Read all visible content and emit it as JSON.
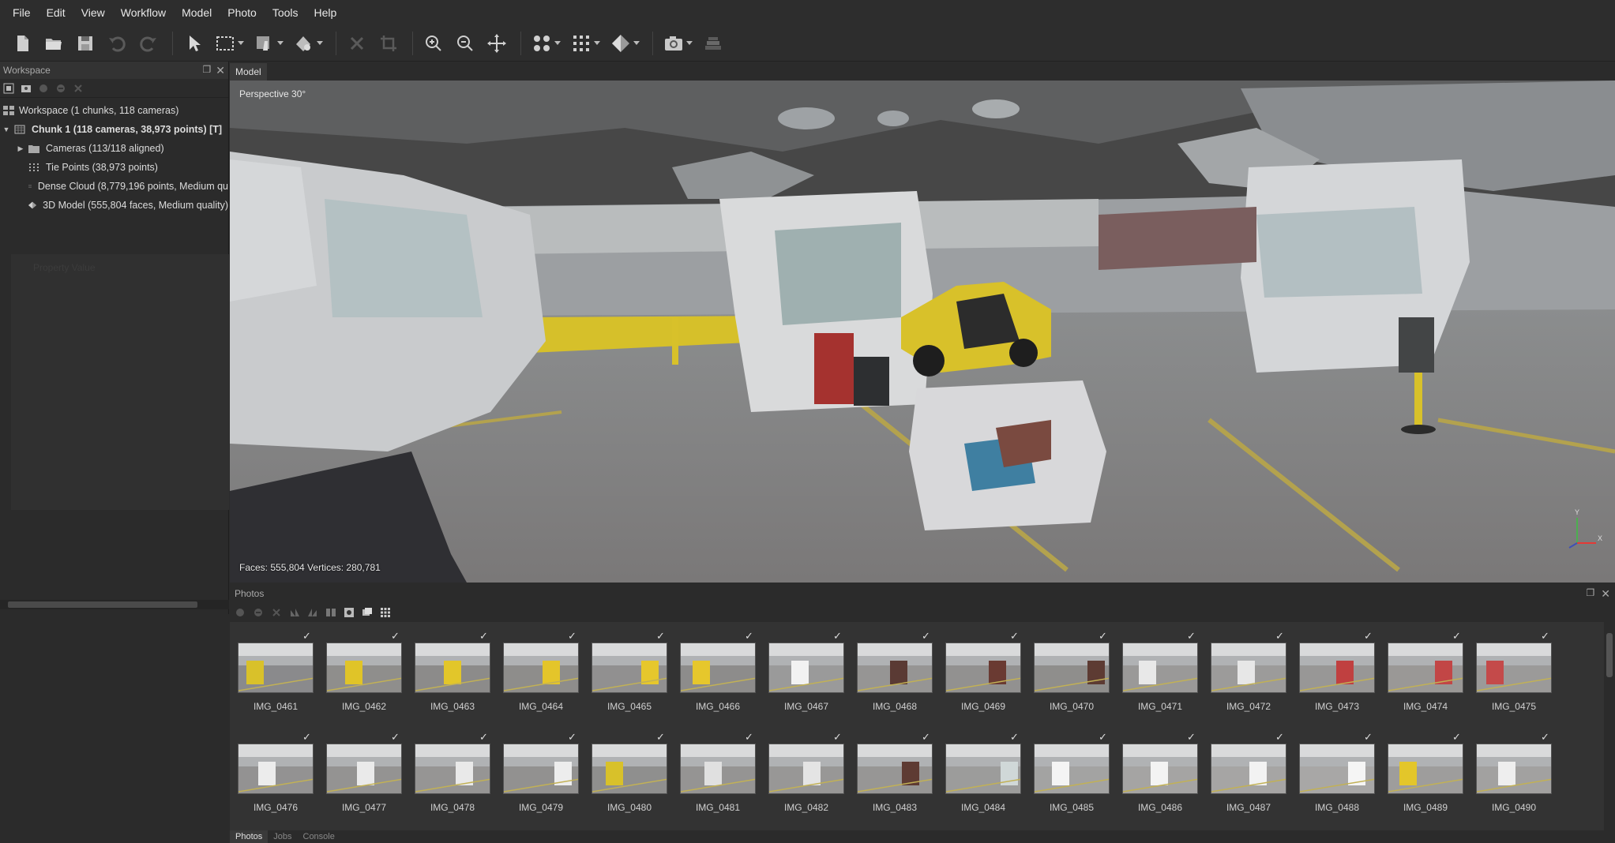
{
  "menu": [
    "File",
    "Edit",
    "View",
    "Workflow",
    "Model",
    "Photo",
    "Tools",
    "Help"
  ],
  "toolbar": {
    "icons": [
      "new-document-icon",
      "open-folder-icon",
      "save-icon",
      "undo-icon",
      "redo-icon",
      "pointer-icon",
      "rectangle-selection-icon",
      "navigation-mode-icon",
      "model-view-icon",
      "delete-icon",
      "crop-icon",
      "zoom-in-icon",
      "zoom-out-icon",
      "move-icon",
      "shaded-view-icon",
      "point-cloud-icon",
      "solid-model-icon",
      "camera-icon",
      "layers-icon"
    ]
  },
  "workspace": {
    "title": "Workspace",
    "tree": [
      {
        "label": "Workspace (1 chunks, 118 cameras)",
        "bold": false,
        "level": 0,
        "arrow": "",
        "icon": "workspace-icon"
      },
      {
        "label": "Chunk 1 (118 cameras, 38,973 points) [T]",
        "bold": true,
        "level": 0,
        "arrow": "▼",
        "icon": "chunk-icon"
      },
      {
        "label": "Cameras (113/118 aligned)",
        "bold": false,
        "level": 1,
        "arrow": "▶",
        "icon": "folder-icon"
      },
      {
        "label": "Tie Points (38,973 points)",
        "bold": false,
        "level": 1,
        "arrow": "",
        "icon": "tie-points-icon"
      },
      {
        "label": "Dense Cloud (8,779,196 points, Medium qu",
        "bold": false,
        "level": 1,
        "arrow": "",
        "icon": "dense-cloud-icon"
      },
      {
        "label": "3D Model (555,804 faces, Medium quality)",
        "bold": false,
        "level": 1,
        "arrow": "",
        "icon": "mesh-icon"
      }
    ],
    "empty_hint": "Property    Value"
  },
  "model": {
    "tab": "Model",
    "view_label": "Perspective 30°",
    "stats": "Faces: 555,804 Vertices: 280,781",
    "axis_x": "X",
    "axis_y": "Y"
  },
  "photos": {
    "title": "Photos",
    "items": [
      {
        "name": "IMG_0461",
        "tone": "#8a8a8c",
        "accent": "#d9c12a"
      },
      {
        "name": "IMG_0462",
        "tone": "#8f8e8c",
        "accent": "#e0c428"
      },
      {
        "name": "IMG_0463",
        "tone": "#8c8b8a",
        "accent": "#e2c62a"
      },
      {
        "name": "IMG_0464",
        "tone": "#8e8d8b",
        "accent": "#e4c52a"
      },
      {
        "name": "IMG_0465",
        "tone": "#919090",
        "accent": "#e6c72c"
      },
      {
        "name": "IMG_0466",
        "tone": "#8d8c8b",
        "accent": "#e6c72c"
      },
      {
        "name": "IMG_0467",
        "tone": "#9a9a9a",
        "accent": "#f2f2f2"
      },
      {
        "name": "IMG_0468",
        "tone": "#969594",
        "accent": "#5a3a34"
      },
      {
        "name": "IMG_0469",
        "tone": "#929190",
        "accent": "#6a3a32"
      },
      {
        "name": "IMG_0470",
        "tone": "#8f8e8c",
        "accent": "#5d3b33"
      },
      {
        "name": "IMG_0471",
        "tone": "#9a9998",
        "accent": "#e8e8e8"
      },
      {
        "name": "IMG_0472",
        "tone": "#9c9b9a",
        "accent": "#e7e7e7"
      },
      {
        "name": "IMG_0473",
        "tone": "#989796",
        "accent": "#c04040"
      },
      {
        "name": "IMG_0474",
        "tone": "#9a9896",
        "accent": "#c24646"
      },
      {
        "name": "IMG_0475",
        "tone": "#9b9a99",
        "accent": "#c44a4a"
      },
      {
        "name": "IMG_0476",
        "tone": "#939292",
        "accent": "#ececec"
      },
      {
        "name": "IMG_0477",
        "tone": "#949392",
        "accent": "#eaeaea"
      },
      {
        "name": "IMG_0478",
        "tone": "#969594",
        "accent": "#e9e9e9"
      },
      {
        "name": "IMG_0479",
        "tone": "#929190",
        "accent": "#ededed"
      },
      {
        "name": "IMG_0480",
        "tone": "#8f8f8e",
        "accent": "#d8c12a"
      },
      {
        "name": "IMG_0481",
        "tone": "#959493",
        "accent": "#e0e0e0"
      },
      {
        "name": "IMG_0482",
        "tone": "#989796",
        "accent": "#e4e4e4"
      },
      {
        "name": "IMG_0483",
        "tone": "#979695",
        "accent": "#5e3b33"
      },
      {
        "name": "IMG_0484",
        "tone": "#9c9c9b",
        "accent": "#d0d8d8"
      },
      {
        "name": "IMG_0485",
        "tone": "#a3a3a2",
        "accent": "#f4f4f4"
      },
      {
        "name": "IMG_0486",
        "tone": "#a5a4a3",
        "accent": "#f3f3f3"
      },
      {
        "name": "IMG_0487",
        "tone": "#a6a5a4",
        "accent": "#f2f2f2"
      },
      {
        "name": "IMG_0488",
        "tone": "#a8a7a6",
        "accent": "#f5f5f5"
      },
      {
        "name": "IMG_0489",
        "tone": "#9e9d9c",
        "accent": "#e3c62a"
      },
      {
        "name": "IMG_0490",
        "tone": "#a2a1a0",
        "accent": "#eeeeee"
      }
    ]
  },
  "bottom_tabs": [
    "Photos",
    "Jobs",
    "Console"
  ]
}
